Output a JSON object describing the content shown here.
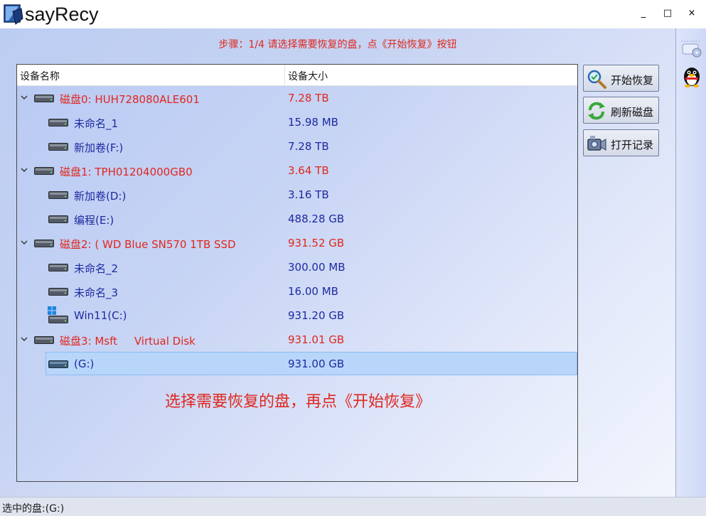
{
  "window": {
    "title": "sayRecy",
    "minimize": "_",
    "maximize": "□",
    "close": "×"
  },
  "step_text": "步骤：1/4 请选择需要恢复的盘，点《开始恢复》按钮",
  "columns": {
    "name": "设备名称",
    "size": "设备大小"
  },
  "rows": [
    {
      "name": "磁盘0: HUH728080ALE601",
      "size": "7.28 TB",
      "level": 0
    },
    {
      "name": "未命名_1",
      "size": "15.98 MB",
      "level": 1
    },
    {
      "name": "新加卷(F:)",
      "size": "7.28 TB",
      "level": 1
    },
    {
      "name": "磁盘1: TPH01204000GB0",
      "size": "3.64 TB",
      "level": 0
    },
    {
      "name": "新加卷(D:)",
      "size": "3.16 TB",
      "level": 1
    },
    {
      "name": "编程(E:)",
      "size": "488.28 GB",
      "level": 1
    },
    {
      "name": "磁盘2: ( WD Blue SN570 1TB SSD",
      "size": "931.52 GB",
      "level": 0
    },
    {
      "name": "未命名_2",
      "size": "300.00 MB",
      "level": 1
    },
    {
      "name": "未命名_3",
      "size": "16.00 MB",
      "level": 1
    },
    {
      "name": "Win11(C:)",
      "size": "931.20 GB",
      "level": 1
    },
    {
      "name": "磁盘3: Msft     Virtual Disk",
      "size": "931.01 GB",
      "level": 0
    },
    {
      "name": "(G:)",
      "size": "931.00 GB",
      "level": 1
    }
  ],
  "hint_text": "选择需要恢复的盘，再点《开始恢复》",
  "buttons": {
    "start": "开始恢复",
    "refresh": "刷新磁盘",
    "open_log": "打开记录"
  },
  "status": "选中的盘:(G:)",
  "colors": {
    "accent_red": "#e0271e",
    "value_blue": "#1e2aa0",
    "selection": "#b8d6fa"
  }
}
